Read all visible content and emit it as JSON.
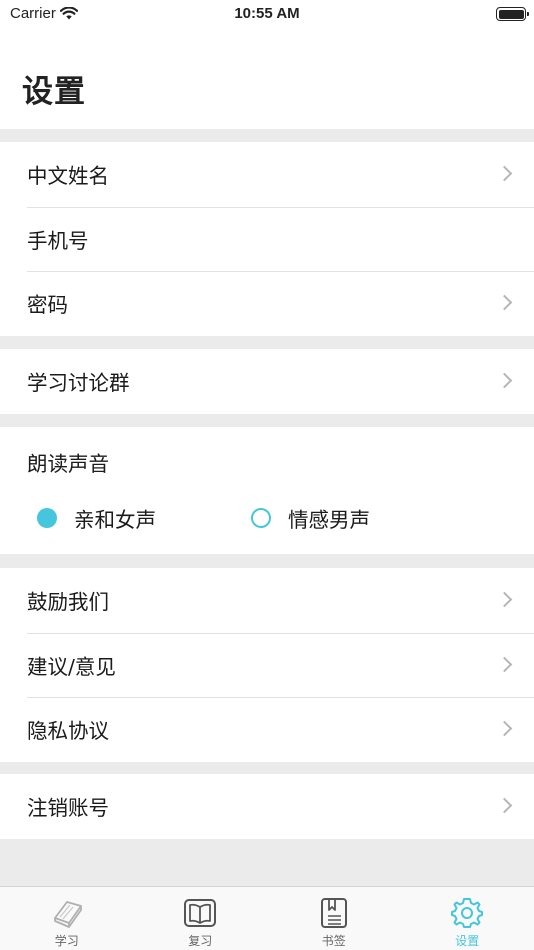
{
  "status_bar": {
    "carrier": "Carrier",
    "time": "10:55 AM"
  },
  "page_title": "设置",
  "account_group": [
    {
      "label": "中文姓名",
      "has_chevron": true
    },
    {
      "label": "手机号",
      "has_chevron": false
    },
    {
      "label": "密码",
      "has_chevron": true
    }
  ],
  "discussion_group": [
    {
      "label": "学习讨论群",
      "has_chevron": true
    }
  ],
  "voice": {
    "label": "朗读声音",
    "options": [
      {
        "label": "亲和女声",
        "selected": true
      },
      {
        "label": "情感男声",
        "selected": false
      }
    ],
    "accent_color": "#46c6dc"
  },
  "feedback_group": [
    {
      "label": "鼓励我们",
      "has_chevron": true
    },
    {
      "label": "建议/意见",
      "has_chevron": true
    },
    {
      "label": "隐私协议",
      "has_chevron": true
    }
  ],
  "account_cancel_group": [
    {
      "label": "注销账号",
      "has_chevron": true
    }
  ],
  "tabbar": {
    "tabs": [
      {
        "label": "学习",
        "icon": "notebook-icon",
        "active": false
      },
      {
        "label": "复习",
        "icon": "open-book-icon",
        "active": false
      },
      {
        "label": "书签",
        "icon": "bookmark-list-icon",
        "active": false
      },
      {
        "label": "设置",
        "icon": "gear-icon",
        "active": true
      }
    ],
    "active_color": "#46c6dc"
  }
}
